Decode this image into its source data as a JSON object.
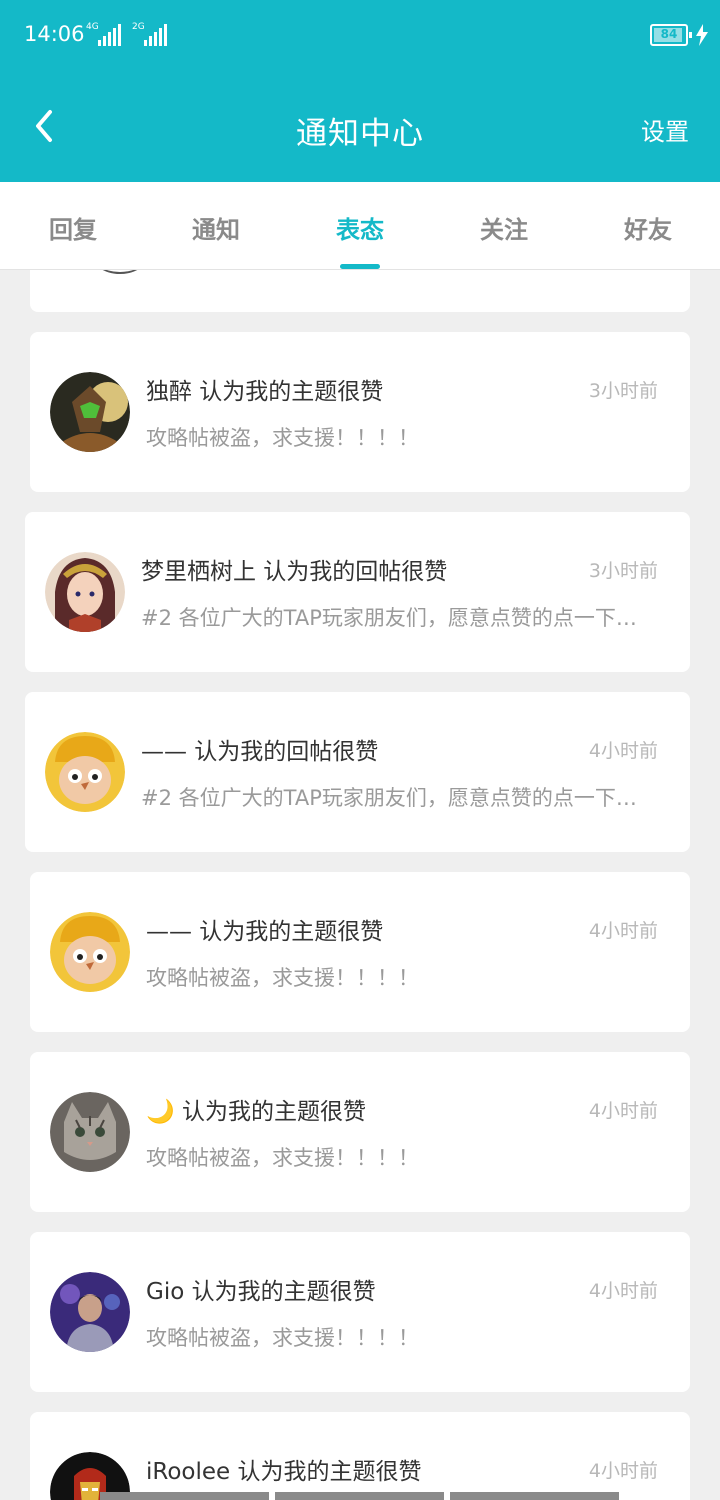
{
  "status_bar": {
    "time": "14:06",
    "sim1_tag": "4G",
    "sim2_tag": "2G",
    "battery": "84"
  },
  "header": {
    "title": "通知中心",
    "settings": "设置",
    "back_icon": "chevron-left-icon"
  },
  "tabs": [
    {
      "label": "回复",
      "active": false
    },
    {
      "label": "通知",
      "active": false
    },
    {
      "label": "表态",
      "active": true
    },
    {
      "label": "关注",
      "active": false
    },
    {
      "label": "好友",
      "active": false
    }
  ],
  "notifications": [
    {
      "line1": "独醉 认为我的主题很赞",
      "line2": "攻略帖被盗，求支援！！！！",
      "time": "3小时前",
      "avatar": "warrior-avatar"
    },
    {
      "line1": "梦里栖树上 认为我的回帖很赞",
      "line2": "#2 各位广大的TAP玩家朋友们，愿意点赞的点一下…",
      "time": "3小时前",
      "avatar": "anime-girl-avatar"
    },
    {
      "line1": "—— 认为我的回帖很赞",
      "line2": "#2 各位广大的TAP玩家朋友们，愿意点赞的点一下…",
      "time": "4小时前",
      "avatar": "cartoon-boy-avatar"
    },
    {
      "line1": "—— 认为我的主题很赞",
      "line2": "攻略帖被盗，求支援！！！！",
      "time": "4小时前",
      "avatar": "cartoon-boy-avatar"
    },
    {
      "line1": "🌙 认为我的主题很赞",
      "line2": "攻略帖被盗，求支援！！！！",
      "time": "4小时前",
      "avatar": "kitten-avatar"
    },
    {
      "line1": "Gio 认为我的主题很赞",
      "line2": "攻略帖被盗，求支援！！！！",
      "time": "4小时前",
      "avatar": "photo-avatar"
    },
    {
      "line1": "iRoolee 认为我的主题很赞",
      "line2": "",
      "time": "4小时前",
      "avatar": "ironman-avatar"
    }
  ],
  "colors": {
    "accent": "#14b9c8",
    "background": "#efefef"
  }
}
